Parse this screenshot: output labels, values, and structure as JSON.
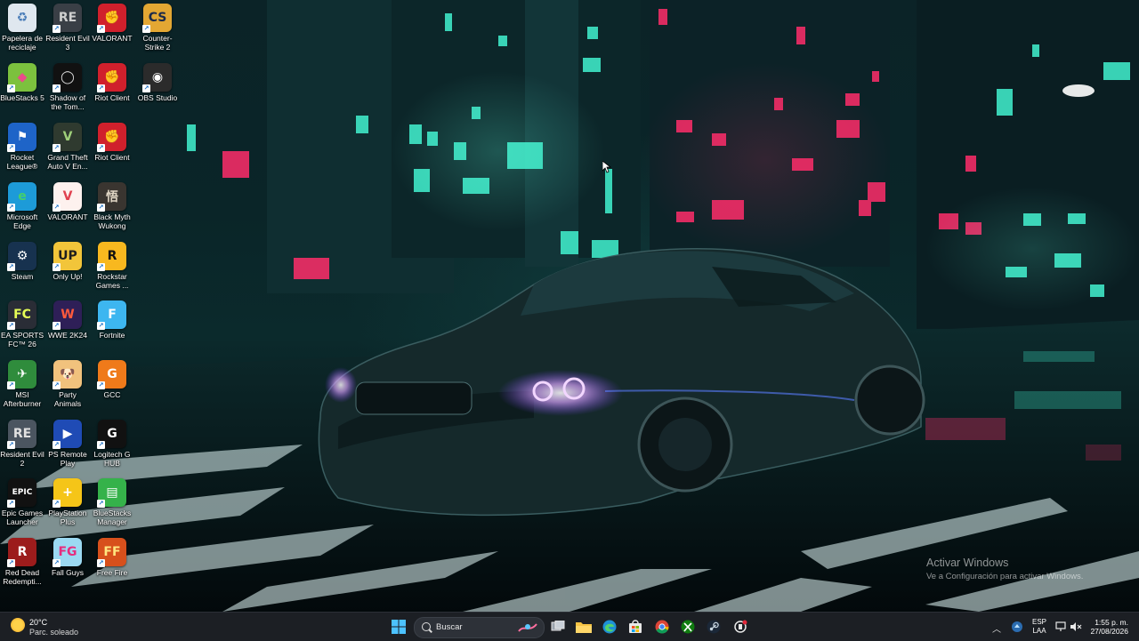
{
  "desktop": {
    "icons": [
      {
        "name": "recycle-bin",
        "label": "Papelera de reciclaje",
        "icon": "recycle-bin-icon",
        "bg": "#dfe7ef",
        "fg": "#4a7db8",
        "glyph": "♻"
      },
      {
        "name": "resident-evil-3",
        "label": "Resident Evil 3",
        "icon": "resident-evil-3-icon",
        "bg": "#3a3f46",
        "fg": "#cfcfcf",
        "glyph": "RE"
      },
      {
        "name": "valorant-riot",
        "label": "VALORANT",
        "icon": "riot-fist-icon",
        "bg": "#d0202c",
        "fg": "#ffffff",
        "glyph": "✊"
      },
      {
        "name": "counter-strike-2",
        "label": "Counter-Strike 2",
        "icon": "counter-strike-icon",
        "bg": "#e3a733",
        "fg": "#1b2a4a",
        "glyph": "CS"
      },
      {
        "name": "bluestacks-5",
        "label": "BlueStacks 5",
        "icon": "bluestacks-icon",
        "bg": "#7cc13e",
        "fg": "#e94b8a",
        "glyph": "◆"
      },
      {
        "name": "shadow-of-the-tomb-raider",
        "label": "Shadow of the Tom...",
        "icon": "tomb-raider-icon",
        "bg": "#111111",
        "fg": "#dddddd",
        "glyph": "◯"
      },
      {
        "name": "riot-client-1",
        "label": "Riot Client",
        "icon": "riot-fist-icon",
        "bg": "#d0202c",
        "fg": "#ffffff",
        "glyph": "✊"
      },
      {
        "name": "obs-studio",
        "label": "OBS Studio",
        "icon": "obs-icon",
        "bg": "#2b2b2b",
        "fg": "#ffffff",
        "glyph": "◉"
      },
      {
        "name": "rocket-league",
        "label": "Rocket League®",
        "icon": "rocket-league-icon",
        "bg": "#1e64c8",
        "fg": "#ffffff",
        "glyph": "⚑"
      },
      {
        "name": "gta-v",
        "label": "Grand Theft Auto V En...",
        "icon": "gta-v-icon",
        "bg": "#2f3a2f",
        "fg": "#9fd07a",
        "glyph": "V"
      },
      {
        "name": "riot-client-2",
        "label": "Riot Client",
        "icon": "riot-fist-icon",
        "bg": "#d0202c",
        "fg": "#ffffff",
        "glyph": "✊"
      },
      {
        "name": "microsoft-edge",
        "label": "Microsoft Edge",
        "icon": "edge-icon",
        "bg": "#1d9bd8",
        "fg": "#45d06a",
        "glyph": "e"
      },
      {
        "name": "valorant",
        "label": "VALORANT",
        "icon": "valorant-icon",
        "bg": "#fdf1ee",
        "fg": "#e0414f",
        "glyph": "V"
      },
      {
        "name": "black-myth-wukong",
        "label": "Black Myth Wukong",
        "icon": "wukong-icon",
        "bg": "#3a3530",
        "fg": "#e0d6c4",
        "glyph": "悟"
      },
      {
        "name": "steam",
        "label": "Steam",
        "icon": "steam-icon",
        "bg": "#17324f",
        "fg": "#ffffff",
        "glyph": "⚙"
      },
      {
        "name": "only-up",
        "label": "Only Up!",
        "icon": "only-up-icon",
        "bg": "#f2c53a",
        "fg": "#1e1e1e",
        "glyph": "UP"
      },
      {
        "name": "rockstar-games",
        "label": "Rockstar Games ...",
        "icon": "rockstar-icon",
        "bg": "#f8b81f",
        "fg": "#111111",
        "glyph": "R"
      },
      {
        "name": "ea-sports-fc26",
        "label": "EA SPORTS FC™ 26",
        "icon": "ea-fc-icon",
        "bg": "#2a2d36",
        "fg": "#e6ff56",
        "glyph": "FC"
      },
      {
        "name": "wwe-2k24",
        "label": "WWE 2K24",
        "icon": "wwe-icon",
        "bg": "#2e1f57",
        "fg": "#ff5a3c",
        "glyph": "W"
      },
      {
        "name": "fortnite",
        "label": "Fortnite",
        "icon": "fortnite-icon",
        "bg": "#3db6f0",
        "fg": "#ffffff",
        "glyph": "F"
      },
      {
        "name": "msi-afterburner",
        "label": "MSI Afterburner",
        "icon": "msi-afterburner-icon",
        "bg": "#2f8c3c",
        "fg": "#ffffff",
        "glyph": "✈"
      },
      {
        "name": "party-animals",
        "label": "Party Animals",
        "icon": "party-animals-icon",
        "bg": "#f1c27d",
        "fg": "#6a3b12",
        "glyph": "🐶"
      },
      {
        "name": "gcc",
        "label": "GCC",
        "icon": "gcc-icon",
        "bg": "#ef7a1a",
        "fg": "#ffffff",
        "glyph": "G"
      },
      {
        "name": "resident-evil-2",
        "label": "Resident Evil 2",
        "icon": "resident-evil-2-icon",
        "bg": "#4b5560",
        "fg": "#e0e0e0",
        "glyph": "RE"
      },
      {
        "name": "ps-remote-play",
        "label": "PS Remote Play",
        "icon": "ps-remote-play-icon",
        "bg": "#1f4bb5",
        "fg": "#ffffff",
        "glyph": "▶"
      },
      {
        "name": "logitech-g-hub",
        "label": "Logitech G HUB",
        "icon": "logitech-icon",
        "bg": "#111111",
        "fg": "#ffffff",
        "glyph": "G"
      },
      {
        "name": "epic-games",
        "label": "Epic Games Launcher",
        "icon": "epic-games-icon",
        "bg": "#111111",
        "fg": "#ffffff",
        "glyph": "EPIC"
      },
      {
        "name": "playstation-plus",
        "label": "PlayStation Plus",
        "icon": "playstation-plus-icon",
        "bg": "#f5c518",
        "fg": "#ffffff",
        "glyph": "+"
      },
      {
        "name": "bluestacks-manager",
        "label": "BlueStacks Manager",
        "icon": "bluestacks-manager-icon",
        "bg": "#35b24a",
        "fg": "#ffffff",
        "glyph": "▤"
      },
      {
        "name": "red-dead-redemption",
        "label": "Red Dead Redempti...",
        "icon": "red-dead-icon",
        "bg": "#9c1c1c",
        "fg": "#ffffff",
        "glyph": "R"
      },
      {
        "name": "fall-guys",
        "label": "Fall Guys",
        "icon": "fall-guys-icon",
        "bg": "#9bd9f2",
        "fg": "#e62d7f",
        "glyph": "FG"
      },
      {
        "name": "free-fire",
        "label": "Free Fire",
        "icon": "free-fire-icon",
        "bg": "#d7501c",
        "fg": "#ffe680",
        "glyph": "FF"
      }
    ]
  },
  "watermark": {
    "title": "Activar Windows",
    "subtitle": "Ve a Configuración para activar Windows."
  },
  "taskbar": {
    "weather": {
      "temp": "20°C",
      "condition": "Parc. soleado",
      "icon": "sun-icon"
    },
    "search": {
      "placeholder": "Buscar"
    },
    "pinned": [
      {
        "name": "start-button",
        "icon": "windows-logo-icon"
      },
      {
        "name": "task-view-button",
        "icon": "task-view-icon"
      },
      {
        "name": "file-explorer-button",
        "icon": "folder-icon"
      },
      {
        "name": "edge-taskbar-button",
        "icon": "edge-icon"
      },
      {
        "name": "store-button",
        "icon": "store-icon"
      },
      {
        "name": "chrome-button",
        "icon": "chrome-icon"
      },
      {
        "name": "xbox-button",
        "icon": "xbox-icon"
      },
      {
        "name": "steam-taskbar-button",
        "icon": "steam-icon"
      },
      {
        "name": "riot-taskbar-button",
        "icon": "riot-icon"
      }
    ],
    "tray": {
      "lang_line1": "ESP",
      "lang_line2": "LAA",
      "time": "1:55 p. m.",
      "date": "27/08/2026"
    }
  },
  "colors": {
    "taskbar": "#1c1f24",
    "neon_cyan": "#3ff5d0",
    "neon_pink": "#ff2d6a",
    "headlight": "#e7b8ff"
  }
}
